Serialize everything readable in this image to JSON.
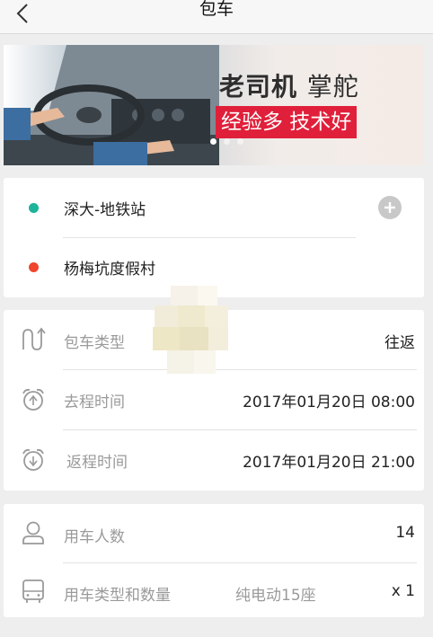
{
  "header": {
    "title": "包车",
    "back_icon": "chevron-left-icon"
  },
  "banner": {
    "headline_bold": "老司机",
    "headline_light": "掌舵",
    "subline": "经验多 技术好",
    "accent_color": "#e0203a",
    "slide_count": 3,
    "active_slide": 1
  },
  "route": {
    "start": {
      "label": "深大-地铁站",
      "dot_color": "#1cb49a"
    },
    "end": {
      "label": "杨梅坑度假村",
      "dot_color": "#f0452d"
    },
    "add_icon": "plus-circle-icon"
  },
  "trip_info": {
    "charter_type": {
      "label": "包车类型",
      "value": "往返",
      "icon": "route-icon"
    },
    "departure": {
      "label": "去程时间",
      "value": "2017年01月20日 08:00",
      "icon": "alarm-up-icon"
    },
    "return": {
      "label": "返程时间",
      "value": "2017年01月20日 21:00",
      "icon": "alarm-down-icon"
    }
  },
  "passengers": {
    "count": {
      "label": "用车人数",
      "value": "14",
      "icon": "person-icon"
    },
    "vehicle": {
      "label": "用车类型和数量",
      "type": "纯电动15座",
      "quantity": "x 1",
      "icon": "bus-icon"
    }
  }
}
